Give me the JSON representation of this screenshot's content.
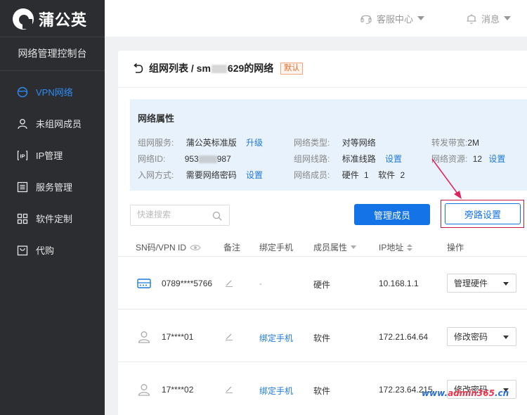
{
  "sidebar": {
    "logo_text": "蒲公英",
    "console_title": "网络管理控制台",
    "items": [
      {
        "label": "VPN网络",
        "icon": "globe-icon",
        "active": true
      },
      {
        "label": "未组网成员",
        "icon": "user-icon"
      },
      {
        "label": "IP管理",
        "icon": "ip-icon"
      },
      {
        "label": "服务管理",
        "icon": "list-icon"
      },
      {
        "label": "软件定制",
        "icon": "grid-icon"
      },
      {
        "label": "代购",
        "icon": "bag-icon"
      }
    ]
  },
  "header": {
    "support": "客服中心",
    "messages": "消息"
  },
  "breadcrumb": {
    "prefix": "组网列表 / sm",
    "suffix": "629的网络",
    "badge": "默认"
  },
  "props": {
    "title": "网络属性",
    "service_label": "组网服务:",
    "service_value": "蒲公英标准版",
    "service_link": "升级",
    "net_type_label": "网络类型:",
    "net_type_value": "对等网络",
    "bandwidth_label": "转发带宽:",
    "bandwidth_value": "2M",
    "net_id_label": "网络ID:",
    "net_id_prefix": "953",
    "net_id_suffix": "987",
    "route_label": "组网线路:",
    "route_value": "标准线路",
    "route_link": "设置",
    "resource_label": "网络资源:",
    "resource_value": "12",
    "resource_link": "设置",
    "join_label": "入网方式:",
    "join_value": "需要网络密码",
    "join_link": "设置",
    "members_label": "网络成员:",
    "members_hw_label": "硬件",
    "members_hw": "1",
    "members_sw_label": "软件",
    "members_sw": "2"
  },
  "toolbar": {
    "search_placeholder": "快速搜索",
    "manage_members": "管理成员",
    "bypass_settings": "旁路设置"
  },
  "table": {
    "headers": [
      "SN码/VPN ID",
      "备注",
      "绑定手机",
      "成员属性",
      "IP地址",
      "操作"
    ],
    "rows": [
      {
        "id": "0789****5766",
        "remark": "",
        "phone": "-",
        "type": "硬件",
        "ip": "10.168.1.1",
        "action": "管理硬件"
      },
      {
        "id": "17****01",
        "remark": "",
        "phone": "绑定手机",
        "type": "软件",
        "ip": "172.21.64.64",
        "action": "修改密码"
      },
      {
        "id": "17****02",
        "remark": "",
        "phone": "绑定手机",
        "type": "软件",
        "ip": "172.23.64.215",
        "action": "修改密码"
      }
    ]
  },
  "watermark": "www.admin365.cn",
  "colors": {
    "accent": "#1473e6",
    "sidebar_bg": "#2b2d30",
    "highlight": "#c41a3c",
    "props_bg": "#e8f2fc"
  }
}
